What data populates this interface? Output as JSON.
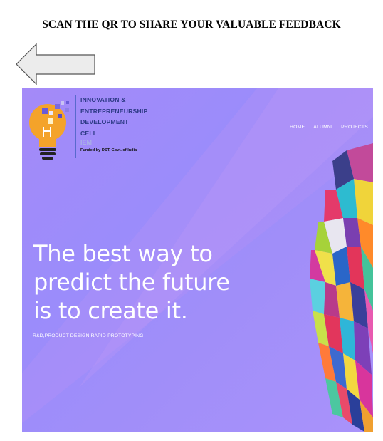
{
  "page": {
    "instruction": "SCAN THE QR TO SHARE YOUR VALUABLE FEEDBACK"
  },
  "arrow": {
    "icon": "left-arrow-icon",
    "fill": "#ececec",
    "stroke": "#555555"
  },
  "hero": {
    "logo": {
      "lines": [
        "INNOVATION &",
        "ENTREPRENEURSHIP",
        "DEVELOPMENT",
        "CELL"
      ],
      "org": "IEM",
      "funded": "Funded by DST, Govt. of India"
    },
    "nav": [
      "HOME",
      "ALUMNI",
      "PROJECTS"
    ],
    "headline": [
      "The best way to",
      "predict the future",
      "is to create it."
    ],
    "tagline": "R&D,PRODUCT DESIGN,RAPID-PROTOTYPING",
    "colors": {
      "bg": "#9f8cf9",
      "logo_text": "#2d3a86",
      "bulb": "#f4a32a"
    }
  }
}
